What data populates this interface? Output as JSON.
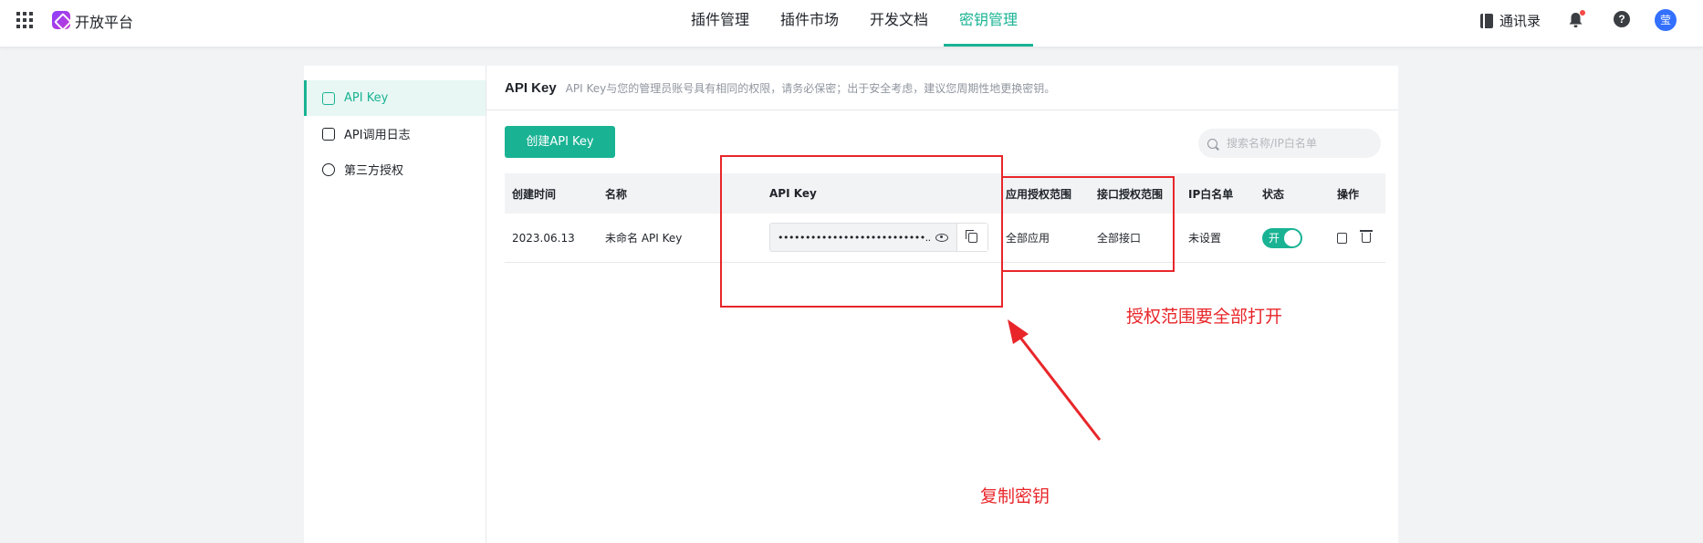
{
  "header": {
    "brand": "开放平台",
    "nav": [
      "插件管理",
      "插件市场",
      "开发文档",
      "密钥管理"
    ],
    "contacts": "通讯录",
    "avatar": "莹"
  },
  "sidebar": {
    "items": [
      {
        "label": "API Key",
        "icon": "key-icon"
      },
      {
        "label": "API调用日志",
        "icon": "log-icon"
      },
      {
        "label": "第三方授权",
        "icon": "check-icon"
      }
    ]
  },
  "main": {
    "title": "API Key",
    "description": "API Key与您的管理员账号具有相同的权限，请务必保密；出于安全考虑，建议您周期性地更换密钥。",
    "create_button": "创建API Key",
    "search_placeholder": "搜索名称/IP白名单"
  },
  "table": {
    "columns": [
      "创建时间",
      "名称",
      "API Key",
      "应用授权范围",
      "接口授权范围",
      "IP白名单",
      "状态",
      "操作"
    ],
    "rows": [
      {
        "created": "2023.06.13",
        "name": "未命名 API Key",
        "key": "•••••••••••••••••••••••••••...",
        "app_scope": "全部应用",
        "api_scope": "全部接口",
        "ip_whitelist": "未设置",
        "status": "开"
      }
    ]
  },
  "annotations": {
    "scope_note": "授权范围要全部打开",
    "copy_note": "复制密钥"
  },
  "colors": {
    "accent": "#19b394",
    "annotation": "#e8262a"
  }
}
